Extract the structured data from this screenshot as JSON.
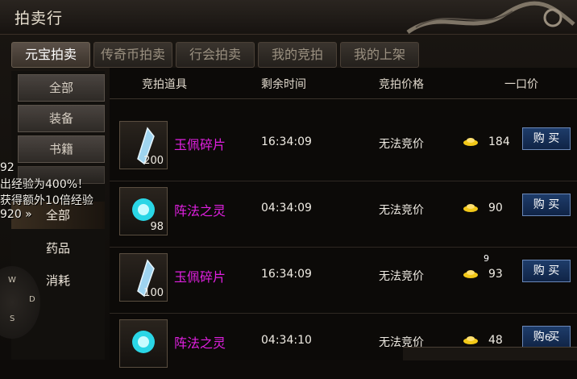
{
  "window": {
    "title": "拍卖行"
  },
  "tabs": [
    {
      "label": "元宝拍卖",
      "active": true
    },
    {
      "label": "传奇币拍卖",
      "active": false
    },
    {
      "label": "行会拍卖",
      "active": false
    },
    {
      "label": "我的竞拍",
      "active": false
    },
    {
      "label": "我的上架",
      "active": false
    }
  ],
  "sidebar": {
    "buttons": [
      "全部",
      "装备",
      "书籍"
    ],
    "items": [
      {
        "label": "全部",
        "selected": true
      },
      {
        "label": "药品",
        "selected": false
      },
      {
        "label": "消耗",
        "selected": false
      }
    ]
  },
  "overlay": {
    "line1": "92",
    "line2": "出经验为400%！",
    "line3": "获得额外10倍经验",
    "line4": "920 »",
    "compass": [
      "W",
      "D",
      "S"
    ]
  },
  "table": {
    "headers": [
      "竞拍道具",
      "剩余时间",
      "竞拍价格",
      "一口价"
    ],
    "rows": [
      {
        "name": "玉佩碎片",
        "qty": "200",
        "time": "16:34:09",
        "bid": "无法竞价",
        "price": "184",
        "buy": "购 买",
        "icon": "crystal-shard-icon"
      },
      {
        "name": "阵法之灵",
        "qty": "98",
        "time": "04:34:09",
        "bid": "无法竞价",
        "price": "90",
        "buy": "购 买",
        "icon": "spirit-orb-icon"
      },
      {
        "name": "玉佩碎片",
        "qty": "100",
        "time": "16:34:09",
        "bid": "无法竞价",
        "price": "93",
        "buy": "购 买",
        "icon": "crystal-shard-icon"
      },
      {
        "name": "阵法之灵",
        "qty": "",
        "time": "04:34:10",
        "bid": "无法竞价",
        "price": "48",
        "buy": "购 买",
        "icon": "spirit-orb-icon"
      }
    ],
    "badge_top": "9",
    "badge_bottom": "6"
  },
  "colors": {
    "item_name": "#e020e0",
    "buy_button": "#1e3c6a",
    "gold": "#f2c818"
  }
}
